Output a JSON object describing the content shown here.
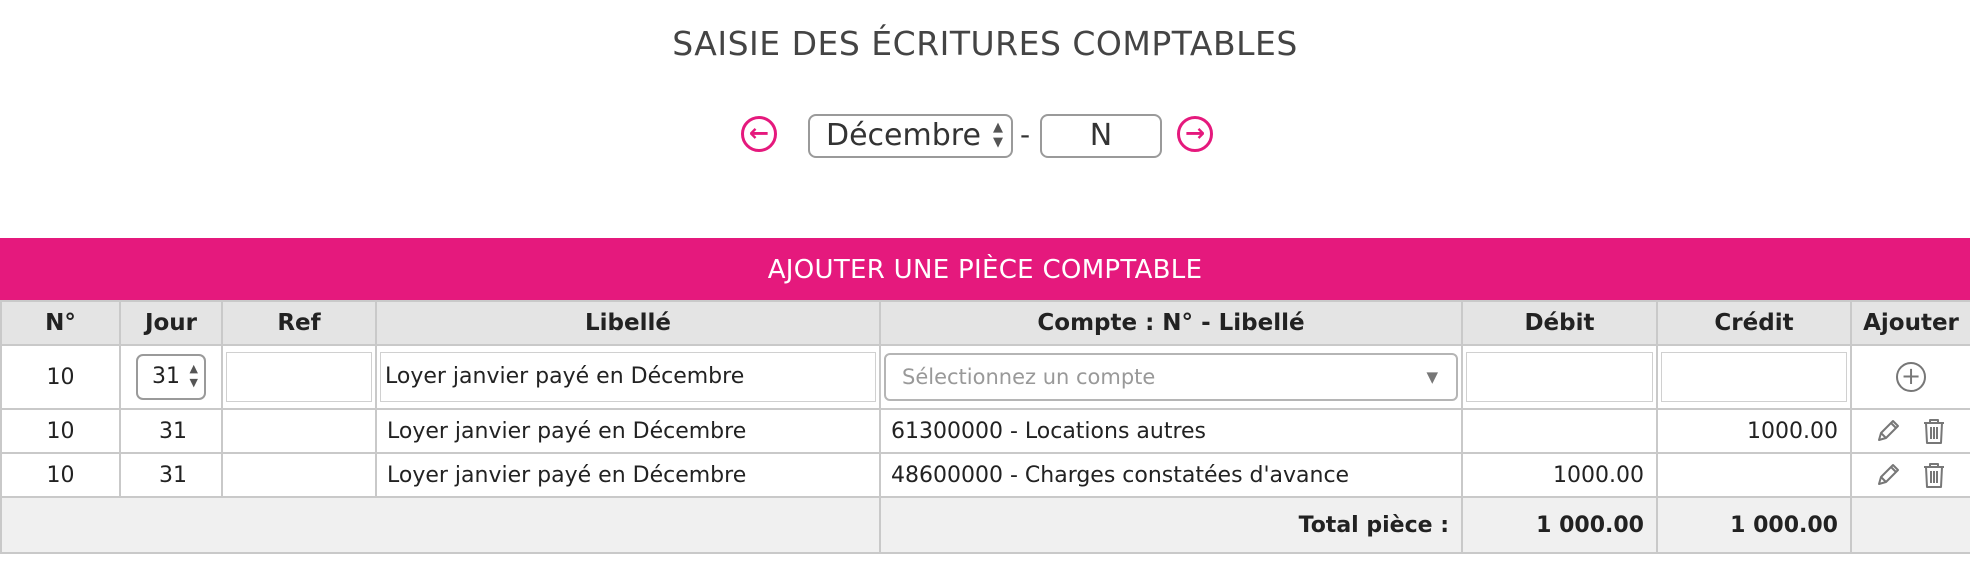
{
  "page": {
    "title": "SAISIE DES ÉCRITURES COMPTABLES"
  },
  "period": {
    "prev_icon": "arrow-left-circle-icon",
    "next_icon": "arrow-right-circle-icon",
    "month": "Décembre",
    "separator": "-",
    "year": "N"
  },
  "add_bar": {
    "label": "AJOUTER UNE PIÈCE COMPTABLE"
  },
  "table": {
    "headers": {
      "num": "N°",
      "day": "Jour",
      "ref": "Ref",
      "label": "Libellé",
      "account": "Compte : N° - Libellé",
      "debit": "Débit",
      "credit": "Crédit",
      "add": "Ajouter"
    },
    "input_row": {
      "num": "10",
      "day": "31",
      "ref": "",
      "label": "Loyer janvier payé en Décembre",
      "account_placeholder": "Sélectionnez un compte",
      "debit": "",
      "credit": "",
      "add_icon": "plus-circle-icon"
    },
    "rows": [
      {
        "num": "10",
        "day": "31",
        "ref": "",
        "label": "Loyer janvier payé en Décembre",
        "account": "61300000 - Locations autres",
        "debit": "",
        "credit": "1000.00"
      },
      {
        "num": "10",
        "day": "31",
        "ref": "",
        "label": "Loyer janvier payé en Décembre",
        "account": "48600000 - Charges constatées d'avance",
        "debit": "1000.00",
        "credit": ""
      }
    ],
    "total": {
      "label": "Total pièce :",
      "debit": "1 000.00",
      "credit": "1 000.00"
    },
    "row_icons": {
      "edit": "pencil-icon",
      "delete": "trash-icon"
    }
  }
}
